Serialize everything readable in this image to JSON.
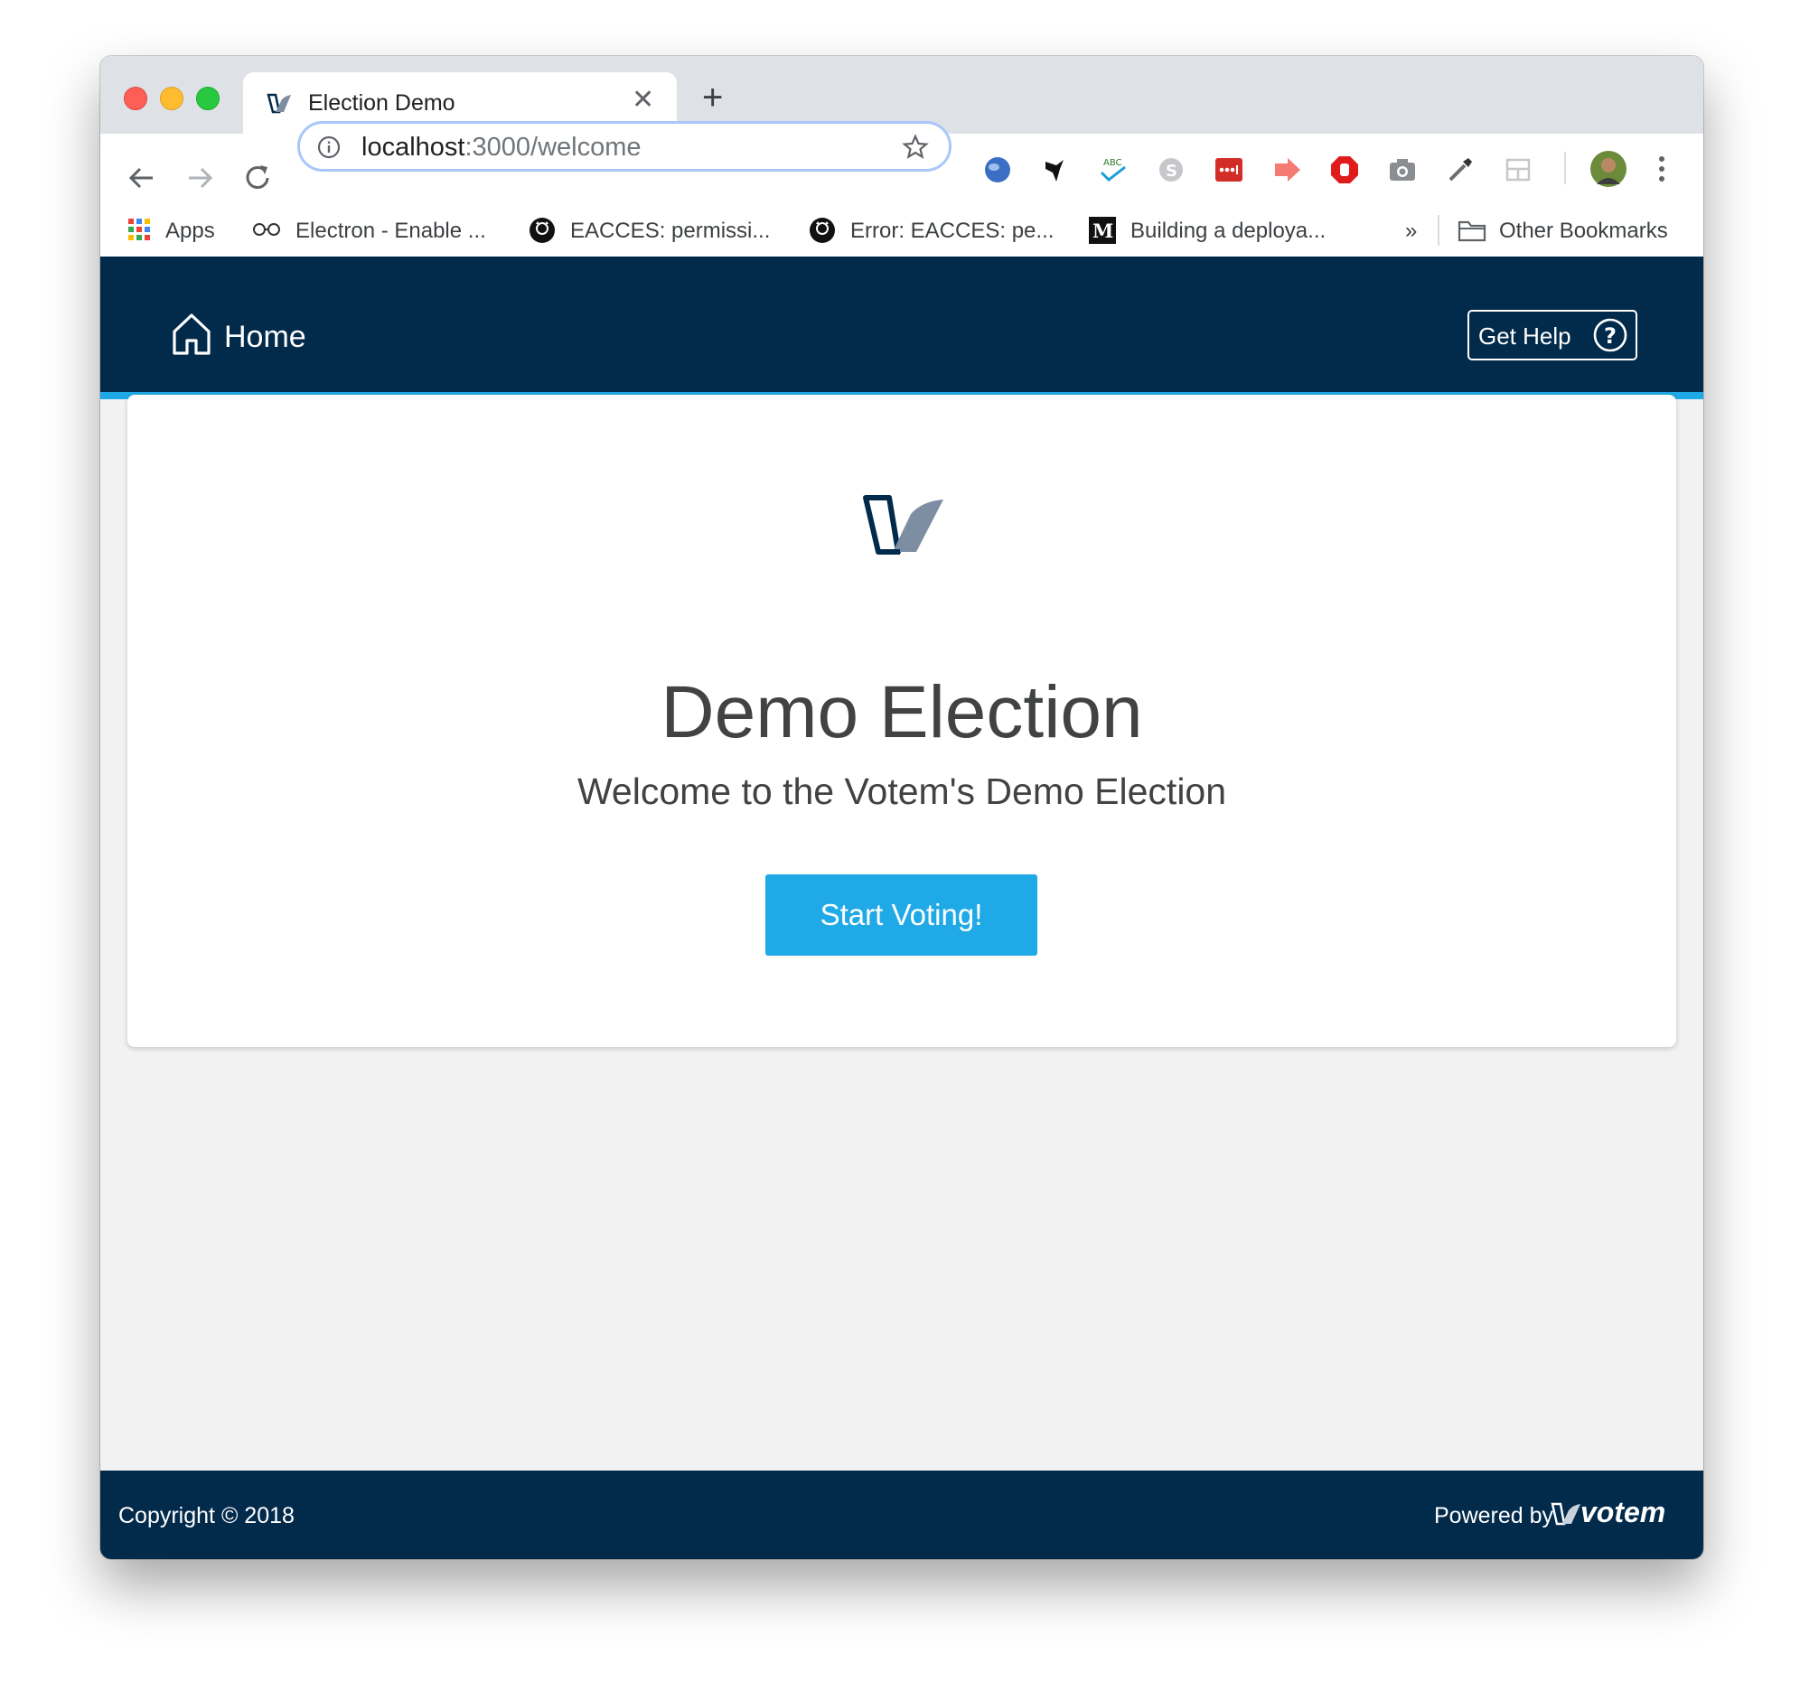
{
  "browser": {
    "tab_title": "Election Demo",
    "url_host": "localhost",
    "url_path": ":3000/welcome"
  },
  "bookmarks": [
    {
      "label": "Apps",
      "icon": "apps-grid-icon"
    },
    {
      "label": "Electron - Enable ...",
      "icon": "glasses-icon"
    },
    {
      "label": "EACCES: permissi...",
      "icon": "github-icon"
    },
    {
      "label": "Error: EACCES: pe...",
      "icon": "github-icon"
    },
    {
      "label": "Building a deploya...",
      "icon": "medium-icon"
    },
    {
      "label": "»",
      "icon": "overflow-chevron"
    },
    {
      "label": "Other Bookmarks",
      "icon": "folder-icon"
    }
  ],
  "extensions": [
    "globe-icon",
    "bird-icon",
    "spellcheck-icon",
    "skype-icon",
    "lastpass-icon",
    "arrow-ext-icon",
    "stop-hand-icon",
    "camera-icon",
    "eyedropper-icon",
    "layout-icon"
  ],
  "header": {
    "home_label": "Home",
    "help_label": "Get Help"
  },
  "welcome": {
    "title": "Demo Election",
    "subtitle": "Welcome to the Votem's Demo Election",
    "start_label": "Start Voting!"
  },
  "footer": {
    "copyright": "Copyright © 2018",
    "powered_by": "Powered by",
    "brand": "votem"
  },
  "colors": {
    "navy": "#022a4b",
    "accent_blue": "#1fa9e6",
    "page_bg": "#f2f2f2"
  }
}
